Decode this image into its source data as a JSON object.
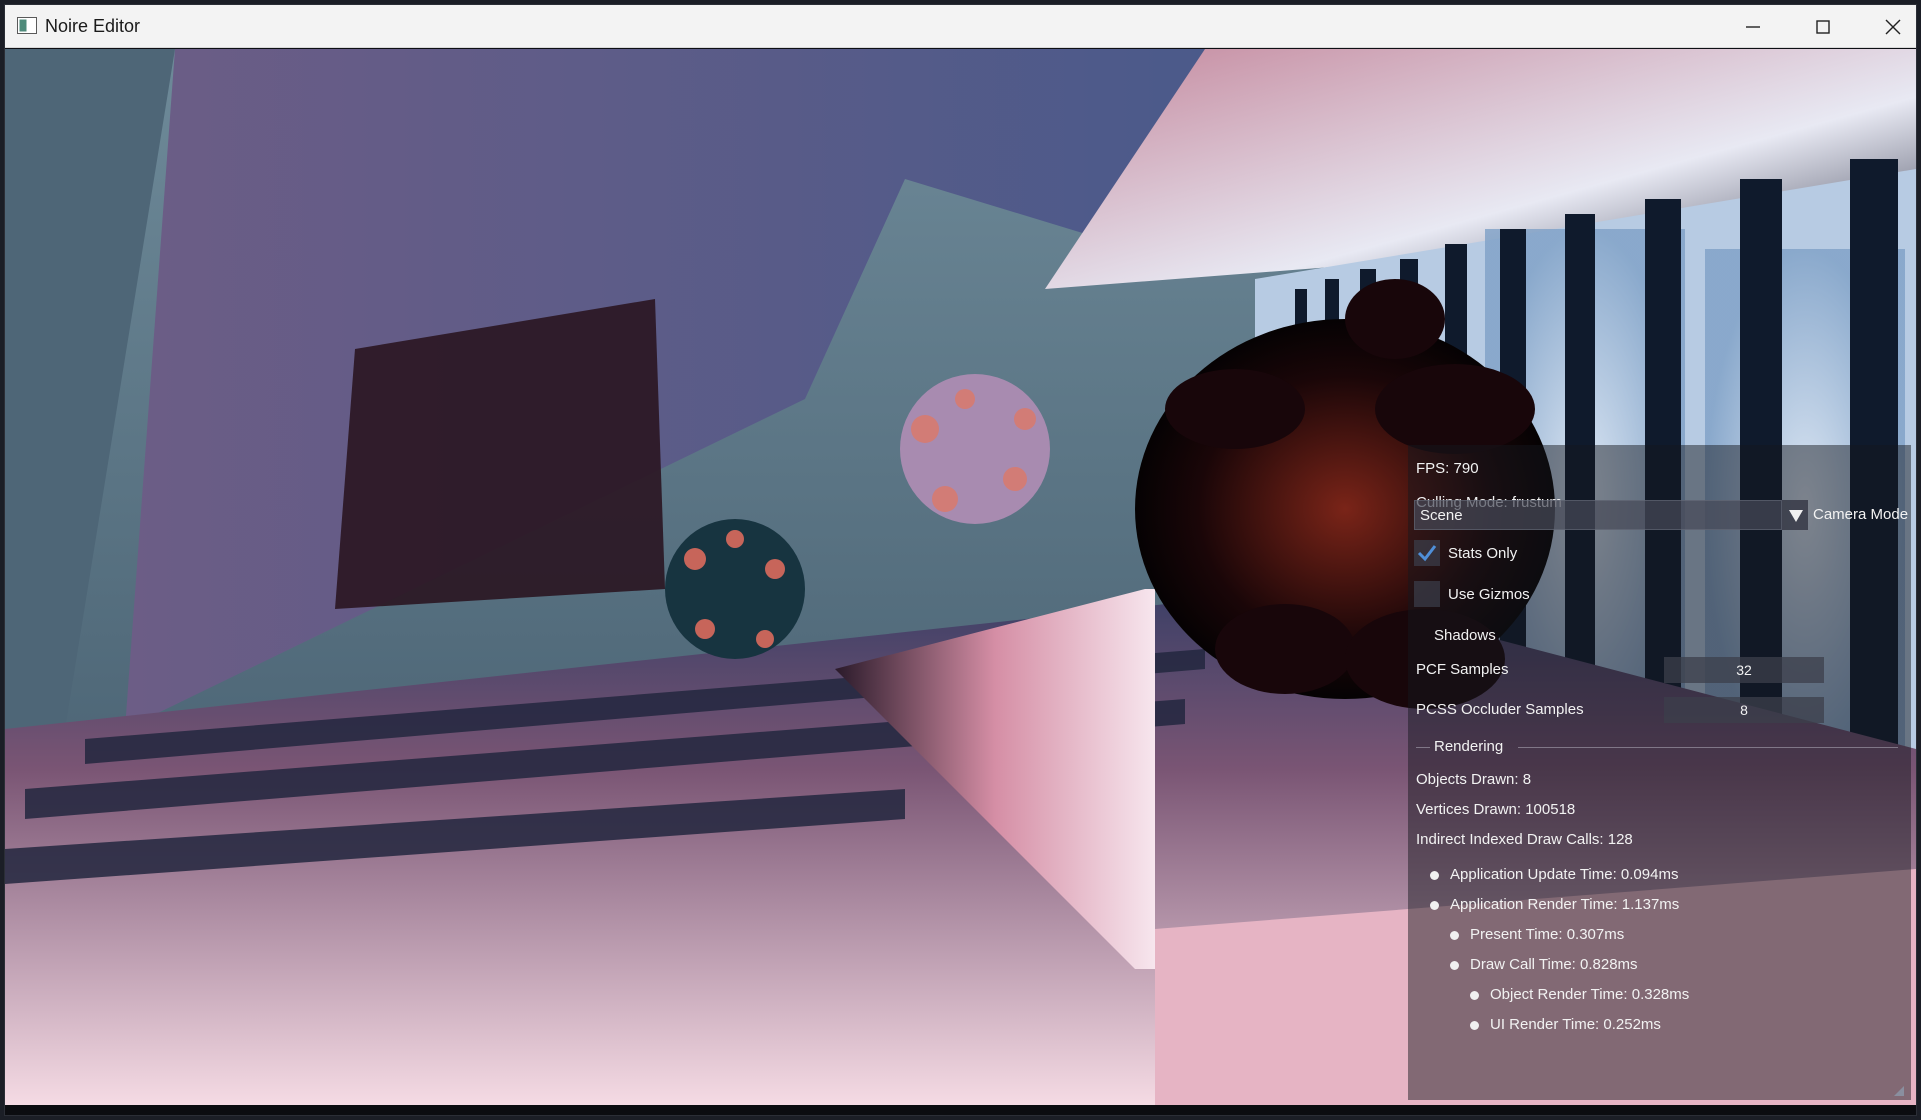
{
  "window": {
    "title": "Noire Editor",
    "controls": {
      "minimize": "minimize-icon",
      "maximize": "maximize-icon",
      "close": "close-icon"
    }
  },
  "stats": {
    "fps": "FPS: 790",
    "culling_mode": "Culling Mode: frustum",
    "scene_select": {
      "value": "Scene"
    },
    "camera_mode_label": "Camera Mode",
    "stats_only": {
      "label": "Stats Only",
      "checked": true
    },
    "use_gizmos": {
      "label": "Use Gizmos",
      "checked": false
    },
    "shadows_label": "Shadows",
    "pcf_samples": {
      "label": "PCF Samples",
      "value": "32"
    },
    "pcss_occluder_samples": {
      "label": "PCSS Occluder Samples",
      "value": "8"
    },
    "rendering_header": "Rendering",
    "objects_drawn": "Objects Drawn: 8",
    "vertices_drawn": "Vertices Drawn: 100518",
    "indirect_draw_calls": "Indirect Indexed Draw Calls: 128",
    "timings": {
      "app_update": "Application Update Time: 0.094ms",
      "app_render": "Application Render Time: 1.137ms",
      "present": "Present Time: 0.307ms",
      "draw_call": "Draw Call Time: 0.828ms",
      "object_render": "Object Render Time: 0.328ms",
      "ui_render": "UI Render Time: 0.252ms"
    }
  },
  "colors": {
    "titlebar": "#f3f3f3",
    "panel_bg": "rgba(20,22,30,0.48)",
    "text": "#f2f2f2"
  }
}
